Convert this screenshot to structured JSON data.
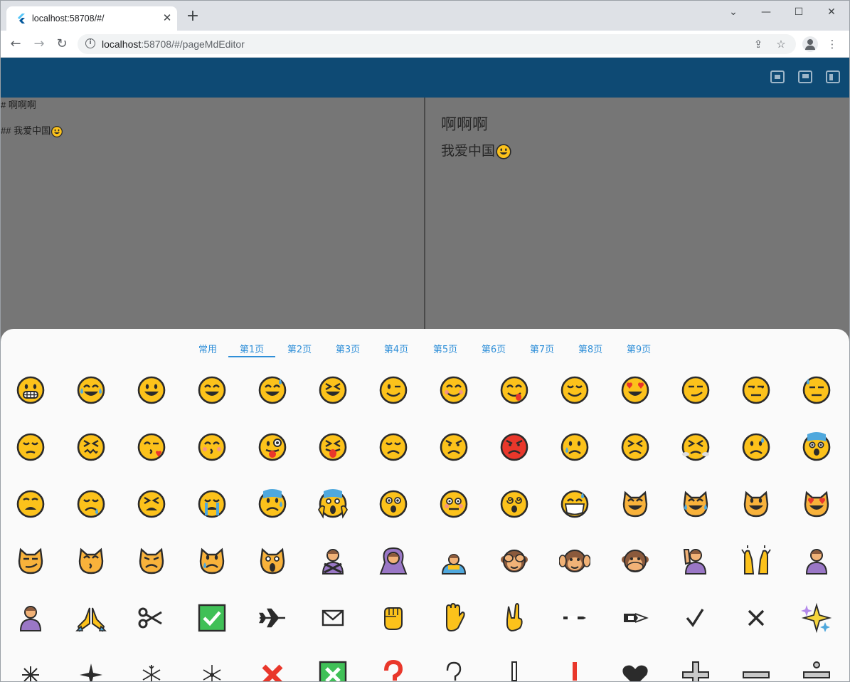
{
  "browser": {
    "tab_title": "localhost:58708/#/",
    "url_host": "localhost",
    "url_rest": ":58708/#/pageMdEditor"
  },
  "editor": {
    "lines": [
      "# 啊啊啊",
      "## 我爱中国"
    ]
  },
  "preview": {
    "h1": "啊啊啊",
    "h2": "我爱中国"
  },
  "emoji_panel": {
    "tabs": [
      "常用",
      "第1页",
      "第2页",
      "第3页",
      "第4页",
      "第5页",
      "第6页",
      "第7页",
      "第8页",
      "第9页"
    ],
    "active_tab": "第1页",
    "emojis": [
      "grin",
      "joy",
      "smiley",
      "smile",
      "sweat-smile",
      "laughing",
      "wink",
      "blush",
      "yum",
      "relieved",
      "heart-eyes",
      "smirk",
      "unamused",
      "sweat",
      "pensive",
      "confounded",
      "kissing-heart",
      "kissing-blush",
      "stuck-out-tongue-wink",
      "stuck-out-tongue-closed",
      "disappointed",
      "angry",
      "rage",
      "cry",
      "persevere",
      "triumph",
      "disappointed-relieved",
      "fearful",
      "weary",
      "sleepy",
      "tired",
      "sob",
      "cold-sweat",
      "scream",
      "astonished",
      "flushed",
      "dizzy",
      "mask",
      "smile-cat",
      "joy-cat",
      "smiley-cat",
      "heart-eyes-cat",
      "smirk-cat",
      "kissing-cat",
      "pouting-cat",
      "crying-cat",
      "scream-cat",
      "no-good",
      "ok-woman",
      "bow",
      "see-no-evil",
      "hear-no-evil",
      "speak-no-evil",
      "raising-hand",
      "raised-hands",
      "person-frowning",
      "person-pouting",
      "pray",
      "scissors",
      "check-mark-button",
      "airplane",
      "envelope",
      "fist",
      "raised-hand",
      "victory-hand",
      "pencil",
      "black-nib",
      "check-mark",
      "multiply",
      "sparkles",
      "eight-spoked-asterisk",
      "eight-pointed-star",
      "snowflake",
      "sparkle",
      "cross-mark",
      "cross-mark-button",
      "question",
      "grey-question",
      "grey-exclamation",
      "exclamation",
      "heavy-heart",
      "plus",
      "minus",
      "divide"
    ]
  }
}
